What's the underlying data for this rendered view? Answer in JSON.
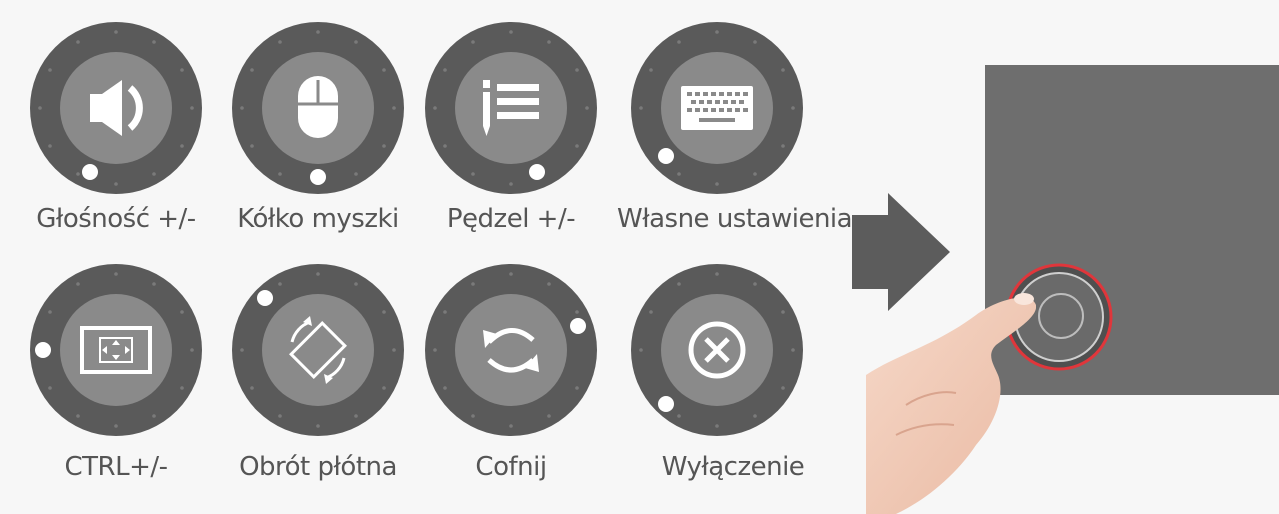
{
  "functions": [
    {
      "label": "Głośność +/-",
      "icon": "speaker-icon",
      "knob": "bottom-left"
    },
    {
      "label": "Kółko myszki",
      "icon": "mouse-icon",
      "knob": "bottom"
    },
    {
      "label": "Pędzel +/-",
      "icon": "brush-icon",
      "knob": "bottom-right"
    },
    {
      "label": "Własne ustawienia",
      "icon": "keyboard-icon",
      "knob": "left-low"
    },
    {
      "label": "CTRL+/-",
      "icon": "zoom-frame-icon",
      "knob": "left"
    },
    {
      "label": "Obrót płótna",
      "icon": "rotate-canvas-icon",
      "knob": "top-left"
    },
    {
      "label": "Cofnij",
      "icon": "undo-arrows-icon",
      "knob": "right"
    },
    {
      "label": "Wyłączenie",
      "icon": "power-off-icon",
      "knob": "left-low"
    }
  ],
  "colors": {
    "dial_outer": "#5a5a5a",
    "dial_inner": "#8a8a8a",
    "label": "#555555",
    "tablet": "#6e6e6e",
    "ring": "#e0363b",
    "arrow": "#5c5c5c"
  },
  "illustration": {
    "arrow": "right-arrow-icon",
    "device": "tablet-dial-illustration",
    "hand": "pointing-hand-icon"
  }
}
